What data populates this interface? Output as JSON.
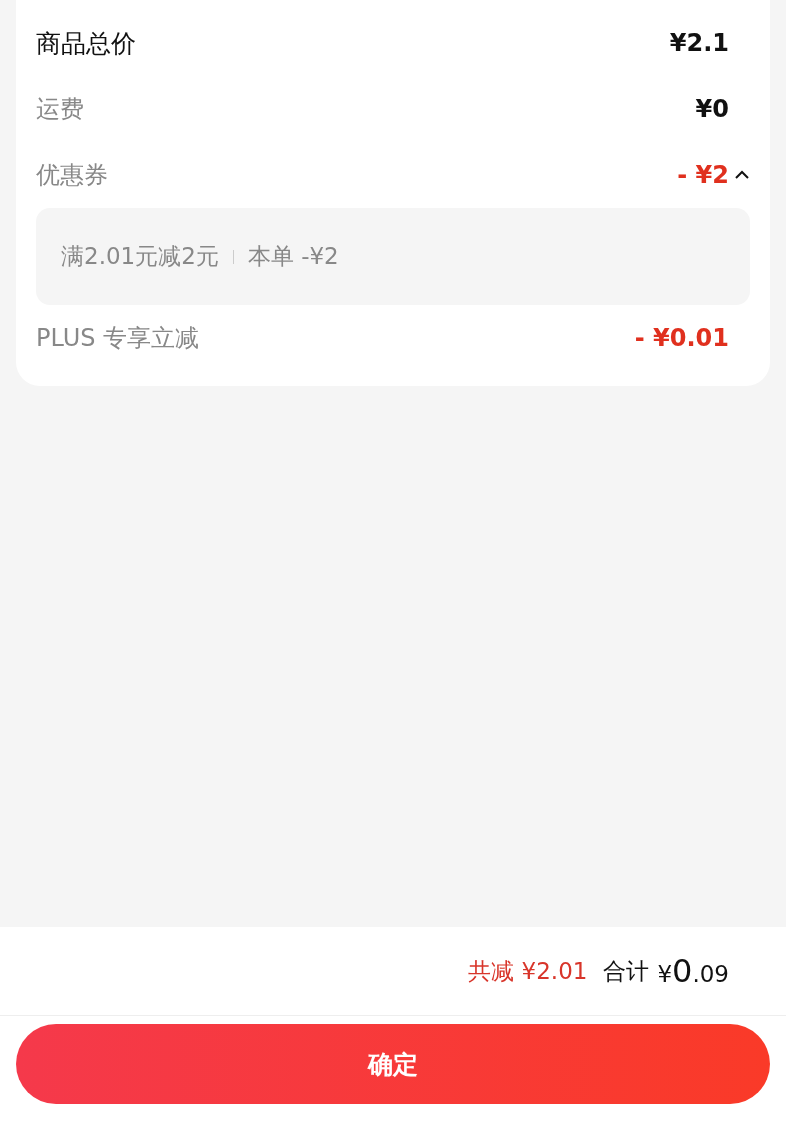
{
  "price_rows": [
    {
      "kind": "primary",
      "label": "商品总价",
      "value": "¥2.1",
      "discount": false
    },
    {
      "kind": "secondary",
      "label": "运费",
      "value": "¥0",
      "discount": false
    },
    {
      "kind": "secondary",
      "label": "优惠券",
      "value": "- ¥2",
      "discount": true,
      "expanded": true,
      "detail": {
        "rule": "满2.01元减2元",
        "saving": "本单 -¥2"
      }
    },
    {
      "kind": "secondary",
      "label": "PLUS 专享立减",
      "value": "- ¥0.01",
      "discount": true
    }
  ],
  "summary": {
    "saved": "共减 ¥2.01",
    "total_label": "合计",
    "total": {
      "symbol": "¥",
      "integer": "0",
      "decimal": ".09"
    }
  },
  "confirm_button": "确定"
}
